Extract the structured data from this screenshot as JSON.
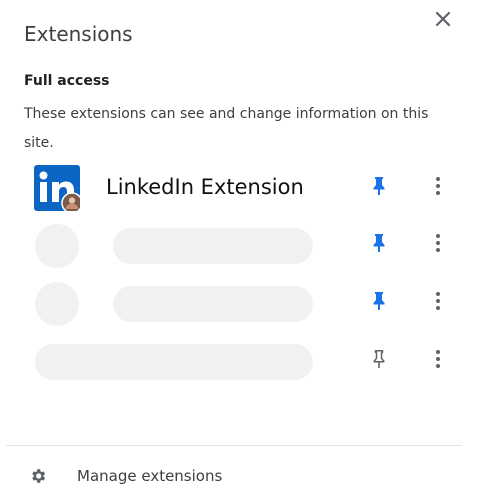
{
  "header": {
    "title": "Extensions",
    "close_icon": "close-icon"
  },
  "section": {
    "heading": "Full access",
    "description": "These extensions can see and change information on this site."
  },
  "extensions": [
    {
      "name": "LinkedIn Extension",
      "logo_text": "in",
      "pinned": true,
      "pin_color": "#1a73e8"
    },
    {
      "name": "",
      "pinned": true,
      "pin_color": "#1a73e8"
    },
    {
      "name": "",
      "pinned": true,
      "pin_color": "#1a73e8"
    },
    {
      "name": "",
      "pinned": false,
      "pin_color": "#5f6368"
    }
  ],
  "footer": {
    "manage_label": "Manage extensions",
    "icon": "gear-icon"
  },
  "colors": {
    "linkedin_blue": "#0a66c2",
    "pin_active": "#1a73e8",
    "skeleton": "#f1f1f1"
  }
}
